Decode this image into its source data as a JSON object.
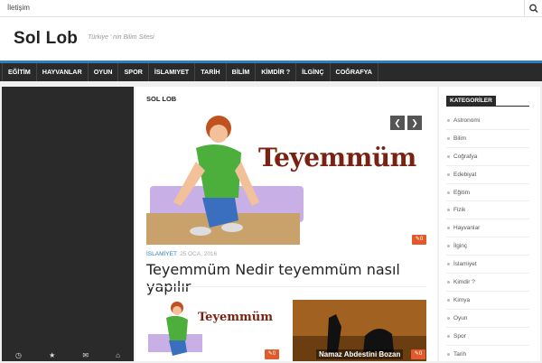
{
  "topbar": {
    "link_label": "İletişim",
    "search_icon": "search-icon"
  },
  "header": {
    "logo": "Sol Lob",
    "tagline": "Türkiye ' nin Bilim Sitesi"
  },
  "nav": {
    "items": [
      "EĞİTİM",
      "HAYVANLAR",
      "OYUN",
      "SPOR",
      "İSLAMIYET",
      "TARİH",
      "BİLİM",
      "KİMDİR ?",
      "İLGİNÇ",
      "COĞRAFYA"
    ]
  },
  "main": {
    "section_title": "SOL LOB",
    "hero": {
      "image_text": "Teyemmüm",
      "comment_count": "0"
    },
    "post": {
      "category": "İSLAMİYET",
      "date": "25 OCA, 2016",
      "title": "Teyemmüm Nedir teyemmüm nasıl yapılır"
    },
    "thumbs": [
      {
        "image_text": "Teyemmüm",
        "comment_count": "0"
      },
      {
        "image_text": "Namaz Abdestini Bozan",
        "comment_count": "0"
      }
    ]
  },
  "sidebar": {
    "title": "KATEGORİLER",
    "items": [
      "Astronomi",
      "Bilim",
      "Coğrafya",
      "Edebiyat",
      "Eğitim",
      "Fizik",
      "Hayvanlar",
      "İlginç",
      "İslamiyet",
      "Kimdir ?",
      "Kimya",
      "Oyun",
      "Spor",
      "Tarih"
    ]
  },
  "colors": {
    "accent": "#2f7fc0",
    "nav_bg": "#2a2a2a",
    "badge": "#e05a2b"
  }
}
